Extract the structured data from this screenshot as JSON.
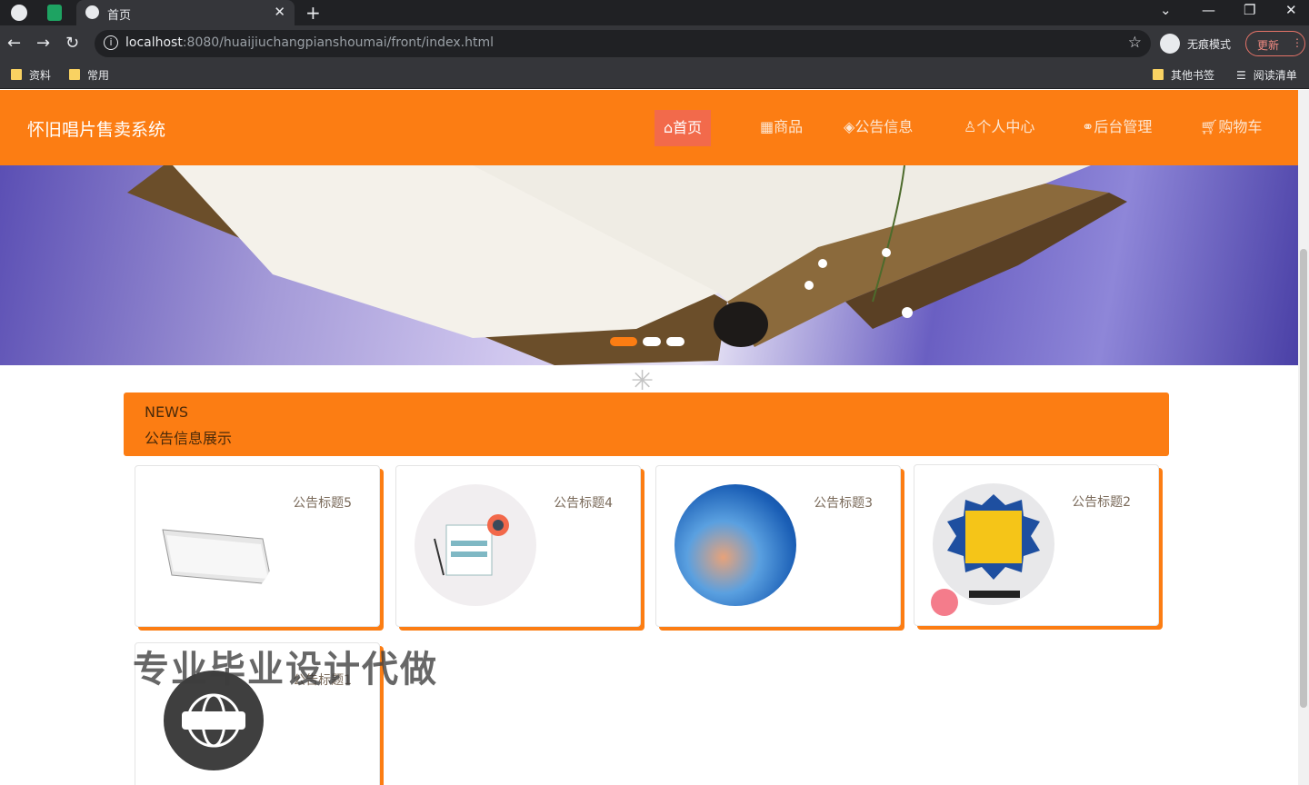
{
  "browser": {
    "tab_title": "首页",
    "url_host": "localhost",
    "url_rest": ":8080/huaijiuchangpianshoumai/front/index.html",
    "incognito_label": "无痕模式",
    "update_label": "更新",
    "bookmarks": [
      "资料",
      "常用"
    ],
    "bookmarks_right": [
      "其他书签",
      "阅读清单"
    ]
  },
  "site": {
    "title": "怀旧唱片售卖系统",
    "nav": [
      {
        "label": "首页",
        "icon": "home-icon"
      },
      {
        "label": "商品",
        "icon": "grid-icon"
      },
      {
        "label": "公告信息",
        "icon": "megaphone-icon"
      },
      {
        "label": "个人中心",
        "icon": "user-icon"
      },
      {
        "label": "后台管理",
        "icon": "link-icon"
      },
      {
        "label": "购物车",
        "icon": "cart-icon"
      }
    ]
  },
  "carousel": {
    "slides": 3,
    "active": 1
  },
  "news": {
    "title_en": "NEWS",
    "title_cn": "公告信息展示",
    "items": [
      {
        "title": "公告标题5",
        "image": "newspaper-news"
      },
      {
        "title": "公告标题4",
        "image": "news-illustration"
      },
      {
        "title": "公告标题3",
        "image": "globe-news"
      },
      {
        "title": "公告标题2",
        "image": "breaking-news-badge"
      },
      {
        "title": "公告标题1",
        "image": "news-globe-badge"
      }
    ]
  },
  "overlay": {
    "watermark": "专业毕业设计代做"
  },
  "colors": {
    "accent": "#fc7d13",
    "nav_active": "#f26a4b",
    "chrome_dark": "#202124",
    "chrome_mid": "#35363a"
  }
}
